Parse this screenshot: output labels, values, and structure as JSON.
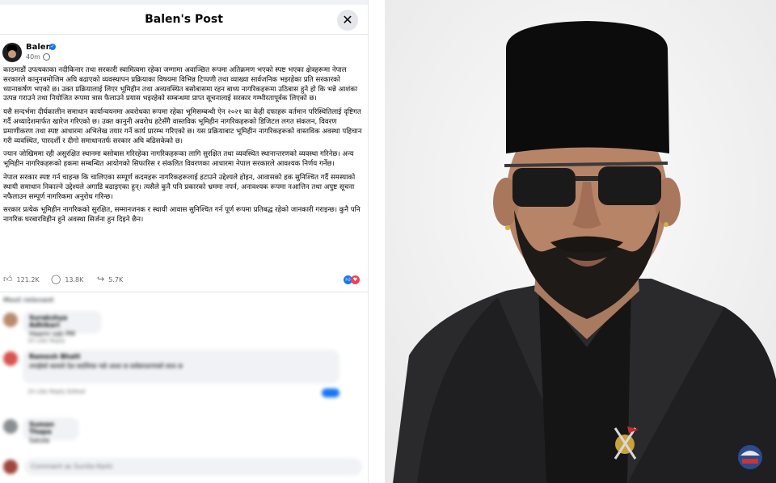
{
  "modal": {
    "title": "Balen's Post",
    "close_symbol": "✕"
  },
  "author": {
    "name": "Balen",
    "time": "40m"
  },
  "post": {
    "paragraphs": [
      "काठमाडौं उपत्यकाका नदीकिनार तथा सरकारी स्वामित्वमा रहेका जग्गामा अवाञ्छित रूपमा अतिक्रमण भएको स्पष्ट भएका क्षेत्रहरूमा नेपाल सरकारले कानुनबमोजिम अघि बढाएको व्यवस्थापन प्रक्रियाका विषयमा विभिन्न टिप्पणी तथा व्याख्या सार्वजनिक भइरहेका प्रति सरकारको ध्यानाकर्षण भएको छ। उक्त प्रक्रियालाई लिएर भूमिहीन तथा अव्यवस्थित बसोबासमा रहन बाध्य नागरिकहरूमा उठिबास हुने हो कि भन्ने आशंका उत्पन्न गराउने तथा नियोजित रूपमा त्रास फैलाउने प्रयास भइरहेको सम्बन्धमा प्राप्त सूचनालाई सरकार गम्भीरतापूर्वक लिएको छ।",
      "यसै सन्दर्भमा दीर्घकालीन समाधान कार्यान्वयनमा अवरोधका रूपमा रहेका भूमिसम्बन्धी ऐन २०२१ का केही दफाहरू वर्तमान परिस्थितिलाई दृष्टिगत गर्दै अध्यादेशमार्फत खारेज गरिएको छ। उक्त कानुनी अवरोध हटेसँगै वास्तविक भूमिहीन नागरिकहरूको डिजिटल लगत संकलन, विवरण प्रमाणीकरण तथा स्पष्ट आधारमा अभिलेख तयार गर्ने कार्य प्रारम्भ गरिएको छ। यस प्रक्रियाबाट भूमिहीन नागरिकहरूको वास्तविक अवस्था पहिचान गरी व्यवस्थित, पारदर्शी र दीगो समाधानतर्फ सरकार अघि बढिसकेको छ।",
      "ज्यान जोखिममा रही असुरक्षित स्थानमा बसोबास गरिरहेका नागरिकहरूका लागि सुरक्षित तथा व्यवस्थित स्थानान्तरणको व्यवस्था गरिनेछ। अन्य भूमिहीन नागरिकहरूको हकमा सम्बन्धित आयोगको सिफारिस र संकलित विवरणका आधारमा नेपाल सरकारले आवश्यक निर्णय गर्नेछ।",
      "नेपाल सरकार स्पष्ट गर्न चाहन्छ कि चालिएका सम्पूर्ण कदमहरू नागरिकहरूलाई हटाउने उद्देश्यले होइन, आवासको हक सुनिश्चित गर्दै समस्याको स्थायी समाधान निकाल्ने उद्देश्यले अगाडि बढाइएका हुन्। त्यसैले कुनै पनि प्रकारको भ्रममा नपर्न, अनावश्यक रूपमा नआत्तिन तथा अपुष्ट सूचना नफैलाउन सम्पूर्ण नागरिकमा अनुरोध गरिन्छ।",
      "सरकार प्रत्येक भूमिहीन नागरिकको सुरक्षित, सम्मानजनक र स्थायी आवास सुनिश्चित गर्न पूर्ण रूपमा प्रतिबद्ध रहेको जानकारी गराइन्छ। कुनै पनि नागरिक घरबारविहीन हुने अवस्था सिर्जना हुन दिइने छैन।"
    ]
  },
  "stats": {
    "likes": "121.2K",
    "comments": "13.8K",
    "shares": "5.7K"
  },
  "comments": {
    "sort_label": "Most relevant",
    "items": [
      {
        "name": "Surakshya Adhikari",
        "text": "Haami sab PM",
        "actions": "1h  Like  Reply"
      },
      {
        "name": "Ramesh Bhatt",
        "text": "तपाईंको कामले देश बदलिन्छ भन्ने आशा छ सर्वसाधारणको साथ छ",
        "actions": "1h  Like  Reply  Edited"
      },
      {
        "name": "Suman Thapa",
        "text": "Salute",
        "actions": "1h  Like  Reply"
      }
    ],
    "composer_placeholder": "Comment as Sunita Karki"
  },
  "colors": {
    "accent": "#1877f2",
    "love": "#f33e58"
  }
}
